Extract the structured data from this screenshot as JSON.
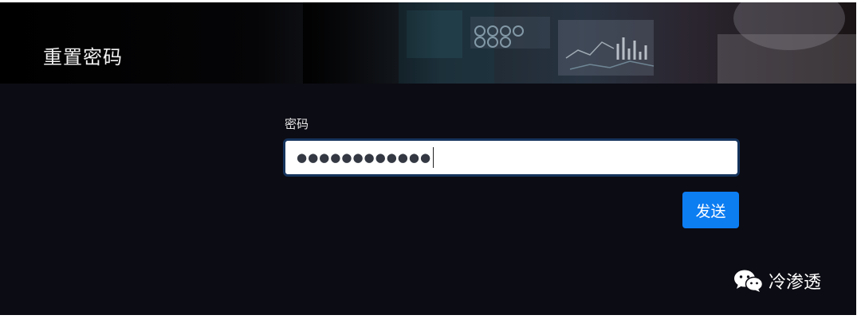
{
  "header": {
    "title": "重置密码"
  },
  "form": {
    "password_label": "密码",
    "password_masked": "●●●●●●●●●●●●",
    "send_label": "发送"
  },
  "watermark": {
    "icon": "wechat-icon",
    "text": "冷渗透"
  },
  "colors": {
    "background": "#0c0c14",
    "button": "#0d7df2",
    "input_border": "#16345d"
  }
}
